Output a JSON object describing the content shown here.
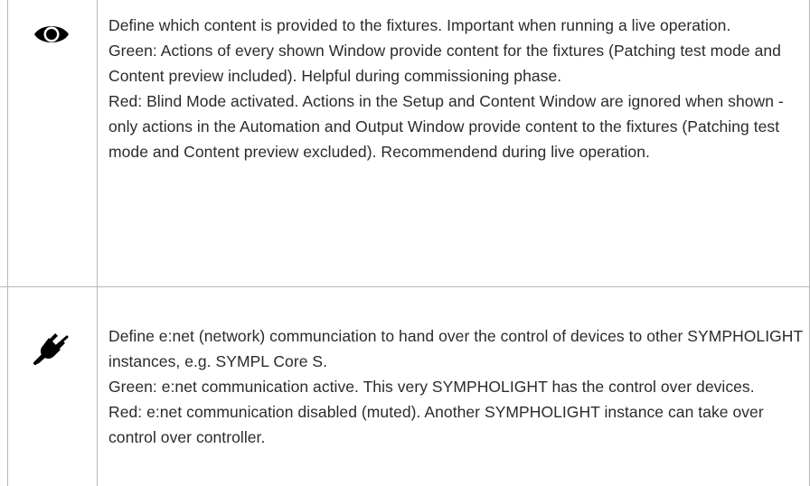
{
  "rows": [
    {
      "icon": "eye-icon",
      "paragraphs": [
        "Define which content is provided to the fixtures. Important when running a live operation.",
        "Green: Actions of every shown Window provide content for  the fixtures (Patching test mode and Content preview included). Helpful during commissioning phase.",
        "Red: Blind Mode activated. Actions in the Setup and Content Window are ignored when shown - only actions in the Automation and Output Window provide content to the fixtures (Patching test mode and Content preview excluded). Recommendend during live operation."
      ]
    },
    {
      "icon": "plug-muted-icon",
      "paragraphs": [
        "Define e:net (network) communciation to hand over the control of devices to other SYMPHOLIGHT instances, e.g. SYMPL Core S.",
        "Green: e:net communication active. This very SYMPHOLIGHT has the control over devices.",
        "Red: e:net communication disabled (muted). Another SYMPHOLIGHT instance can take over control over controller."
      ]
    }
  ]
}
